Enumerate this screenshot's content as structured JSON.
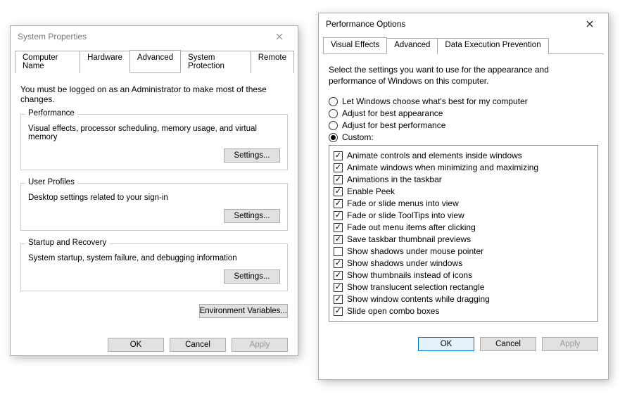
{
  "sysprops": {
    "title": "System Properties",
    "tabs": [
      "Computer Name",
      "Hardware",
      "Advanced",
      "System Protection",
      "Remote"
    ],
    "active_tab": 2,
    "instruction": "You must be logged on as an Administrator to make most of these changes.",
    "groups": {
      "performance": {
        "label": "Performance",
        "desc": "Visual effects, processor scheduling, memory usage, and virtual memory",
        "button": "Settings..."
      },
      "profiles": {
        "label": "User Profiles",
        "desc": "Desktop settings related to your sign-in",
        "button": "Settings..."
      },
      "startup": {
        "label": "Startup and Recovery",
        "desc": "System startup, system failure, and debugging information",
        "button": "Settings..."
      }
    },
    "env_button": "Environment Variables...",
    "ok": "OK",
    "cancel": "Cancel",
    "apply": "Apply"
  },
  "perfopts": {
    "title": "Performance Options",
    "tabs": [
      "Visual Effects",
      "Advanced",
      "Data Execution Prevention"
    ],
    "active_tab": 0,
    "desc": "Select the settings you want to use for the appearance and performance of Windows on this computer.",
    "radios": [
      {
        "label": "Let Windows choose what's best for my computer",
        "checked": false
      },
      {
        "label": "Adjust for best appearance",
        "checked": false
      },
      {
        "label": "Adjust for best performance",
        "checked": false
      },
      {
        "label": "Custom:",
        "checked": true
      }
    ],
    "checks": [
      {
        "label": "Animate controls and elements inside windows",
        "checked": true
      },
      {
        "label": "Animate windows when minimizing and maximizing",
        "checked": true
      },
      {
        "label": "Animations in the taskbar",
        "checked": true
      },
      {
        "label": "Enable Peek",
        "checked": true
      },
      {
        "label": "Fade or slide menus into view",
        "checked": true
      },
      {
        "label": "Fade or slide ToolTips into view",
        "checked": true
      },
      {
        "label": "Fade out menu items after clicking",
        "checked": true
      },
      {
        "label": "Save taskbar thumbnail previews",
        "checked": true
      },
      {
        "label": "Show shadows under mouse pointer",
        "checked": false
      },
      {
        "label": "Show shadows under windows",
        "checked": true
      },
      {
        "label": "Show thumbnails instead of icons",
        "checked": true
      },
      {
        "label": "Show translucent selection rectangle",
        "checked": true
      },
      {
        "label": "Show window contents while dragging",
        "checked": true
      },
      {
        "label": "Slide open combo boxes",
        "checked": true
      }
    ],
    "ok": "OK",
    "cancel": "Cancel",
    "apply": "Apply"
  }
}
